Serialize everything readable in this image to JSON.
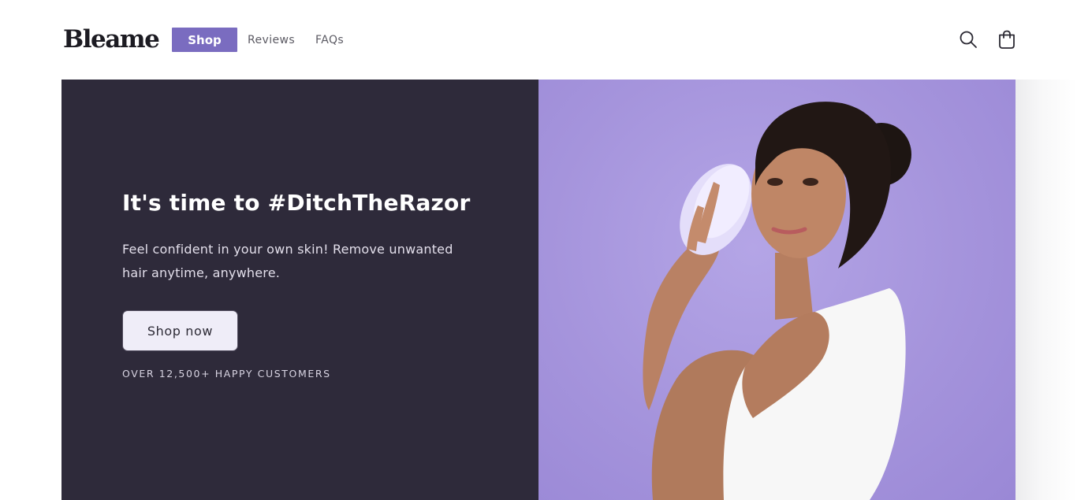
{
  "header": {
    "logo": "Bleame",
    "nav": {
      "shop": "Shop",
      "reviews": "Reviews",
      "faqs": "FAQs"
    },
    "icons": {
      "search": "search-icon",
      "cart": "cart-icon"
    }
  },
  "hero": {
    "title": "It's time to #DitchTheRazor",
    "text": "Feel confident in your own skin! Remove unwanted hair anytime, anywhere.",
    "button": "Shop now",
    "customers": "OVER 12,500+ HAPPY CUSTOMERS"
  },
  "colors": {
    "accent": "#7a6cc0",
    "hero_dark": "#2e2a3a",
    "hero_lavender": "#a594dc",
    "button_bg": "#efedf8"
  }
}
